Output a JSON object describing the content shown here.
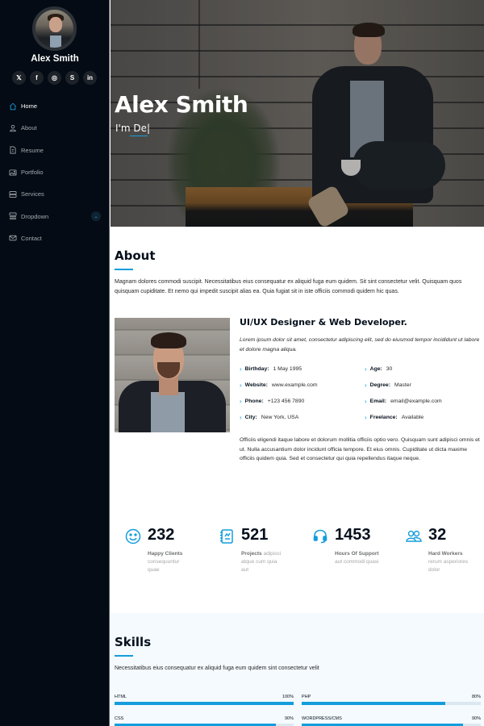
{
  "sidebar": {
    "name": "Alex Smith",
    "social": [
      {
        "icon": "x-twitter-icon",
        "glyph": "𝕏"
      },
      {
        "icon": "facebook-icon",
        "glyph": "f"
      },
      {
        "icon": "instagram-icon",
        "glyph": "◎"
      },
      {
        "icon": "skype-icon",
        "glyph": "S"
      },
      {
        "icon": "linkedin-icon",
        "glyph": "in"
      }
    ],
    "nav": [
      {
        "label": "Home",
        "icon": "house-icon",
        "active": true
      },
      {
        "label": "About",
        "icon": "person-icon"
      },
      {
        "label": "Resume",
        "icon": "file-icon"
      },
      {
        "label": "Portfolio",
        "icon": "images-icon"
      },
      {
        "label": "Services",
        "icon": "hdd-stack-icon"
      },
      {
        "label": "Dropdown",
        "icon": "menu-button-icon",
        "has_submenu": true
      },
      {
        "label": "Contact",
        "icon": "envelope-icon"
      }
    ],
    "dropdown_chevron": "⌄"
  },
  "hero": {
    "title": "Alex Smith",
    "subtitle_prefix": "I'm ",
    "typed_text": "De",
    "cursor": "|"
  },
  "about": {
    "title": "About",
    "intro": "Magnam dolores commodi suscipit. Necessitatibus eius consequatur ex aliquid fuga eum quidem. Sit sint consectetur velit. Quisquam quos quisquam cupiditate. Et nemo qui impedit suscipit alias ea. Quia fugiat sit in iste officiis commodi quidem hic quas.",
    "role": "UI/UX Designer & Web Developer.",
    "role_desc": "Lorem ipsum dolor sit amet, consectetur adipiscing elit, sed do eiusmod tempor incididunt ut labore et dolore magna aliqua.",
    "facts_left": [
      {
        "key": "Birthday:",
        "value": "1 May 1995"
      },
      {
        "key": "Website:",
        "value": "www.example.com"
      },
      {
        "key": "Phone:",
        "value": "+123 456 7890"
      },
      {
        "key": "City:",
        "value": "New York, USA"
      }
    ],
    "facts_right": [
      {
        "key": "Age:",
        "value": "30"
      },
      {
        "key": "Degree:",
        "value": "Master"
      },
      {
        "key": "Email:",
        "value": "email@example.com"
      },
      {
        "key": "Freelance:",
        "value": "Available"
      }
    ],
    "arrow": "›",
    "more": "Officiis eligendi itaque labore et dolorum mollitia officiis optio vero. Quisquam sunt adipisci omnis et ut. Nulla accusantium dolor incidunt officia tempore. Et eius omnis. Cupiditate ut dicta maxime officiis quidem quia. Sed et consectetur qui quia repellendus itaque neque."
  },
  "stats": [
    {
      "icon": "emoji-smile-icon",
      "number": "232",
      "label_bold": "Happy Clients",
      "label_rest": " consequuntur quae"
    },
    {
      "icon": "journal-richtext-icon",
      "number": "521",
      "label_bold": "Projects",
      "label_rest": " adipisci atque cum quia aut"
    },
    {
      "icon": "headset-icon",
      "number": "1453",
      "label_bold": "Hours Of Support",
      "label_rest": " aut commodi quasi"
    },
    {
      "icon": "people-icon",
      "number": "32",
      "label_bold": "Hard Workers",
      "label_rest": " rerum asperiores dolor"
    }
  ],
  "skills": {
    "title": "Skills",
    "intro": "Necessitatibus eius consequatur ex aliquid fuga eum quidem sint consectetur velit",
    "items": [
      {
        "name": "HTML",
        "value_label": "100%",
        "percent": 100
      },
      {
        "name": "PHP",
        "value_label": "80%",
        "percent": 80
      },
      {
        "name": "CSS",
        "value_label": "90%",
        "percent": 90
      },
      {
        "name": "WordPress/CMS",
        "value_label": "90%",
        "percent": 90
      }
    ]
  },
  "colors": {
    "accent": "#149ddd",
    "sidebar_bg": "#040b14",
    "heading": "#05101c",
    "skills_bg": "#f4fafd"
  }
}
